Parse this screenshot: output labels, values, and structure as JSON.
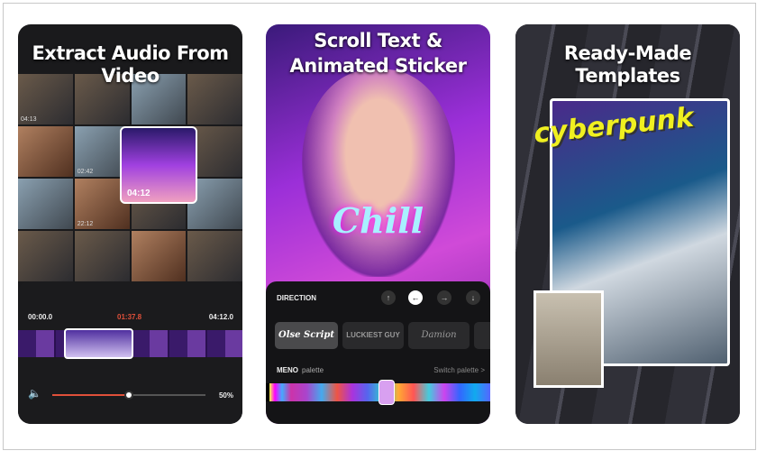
{
  "panels": [
    {
      "title": "Extract Audio From Video",
      "grid_timestamps": [
        "04:13",
        "",
        "",
        "",
        "",
        "02:42",
        "",
        "",
        "",
        "22:12",
        "",
        ""
      ],
      "preview_time": "04:12",
      "timeline": {
        "start": "00:00.0",
        "current": "01:37.8",
        "end": "04:12.0"
      },
      "volume": {
        "percent_label": "50%",
        "level": 0.5
      },
      "accent": "#e0503a"
    },
    {
      "title_line1": "Scroll Text &",
      "title_line2": "Animated Sticker",
      "sticker_text": "Chill",
      "direction_label": "DIRECTION",
      "arrows": [
        "↑",
        "←",
        "→",
        "↓"
      ],
      "selected_arrow": "←",
      "fonts": [
        "Olse Script",
        "LUCKIEST GUY",
        "Damion"
      ],
      "selected_font": "Olse Script",
      "palette_name": "MENO",
      "palette_label": "palette",
      "switch_palette": "Switch palette >"
    },
    {
      "title": "Ready-Made Templates",
      "template_text": "cyberpunk"
    }
  ]
}
